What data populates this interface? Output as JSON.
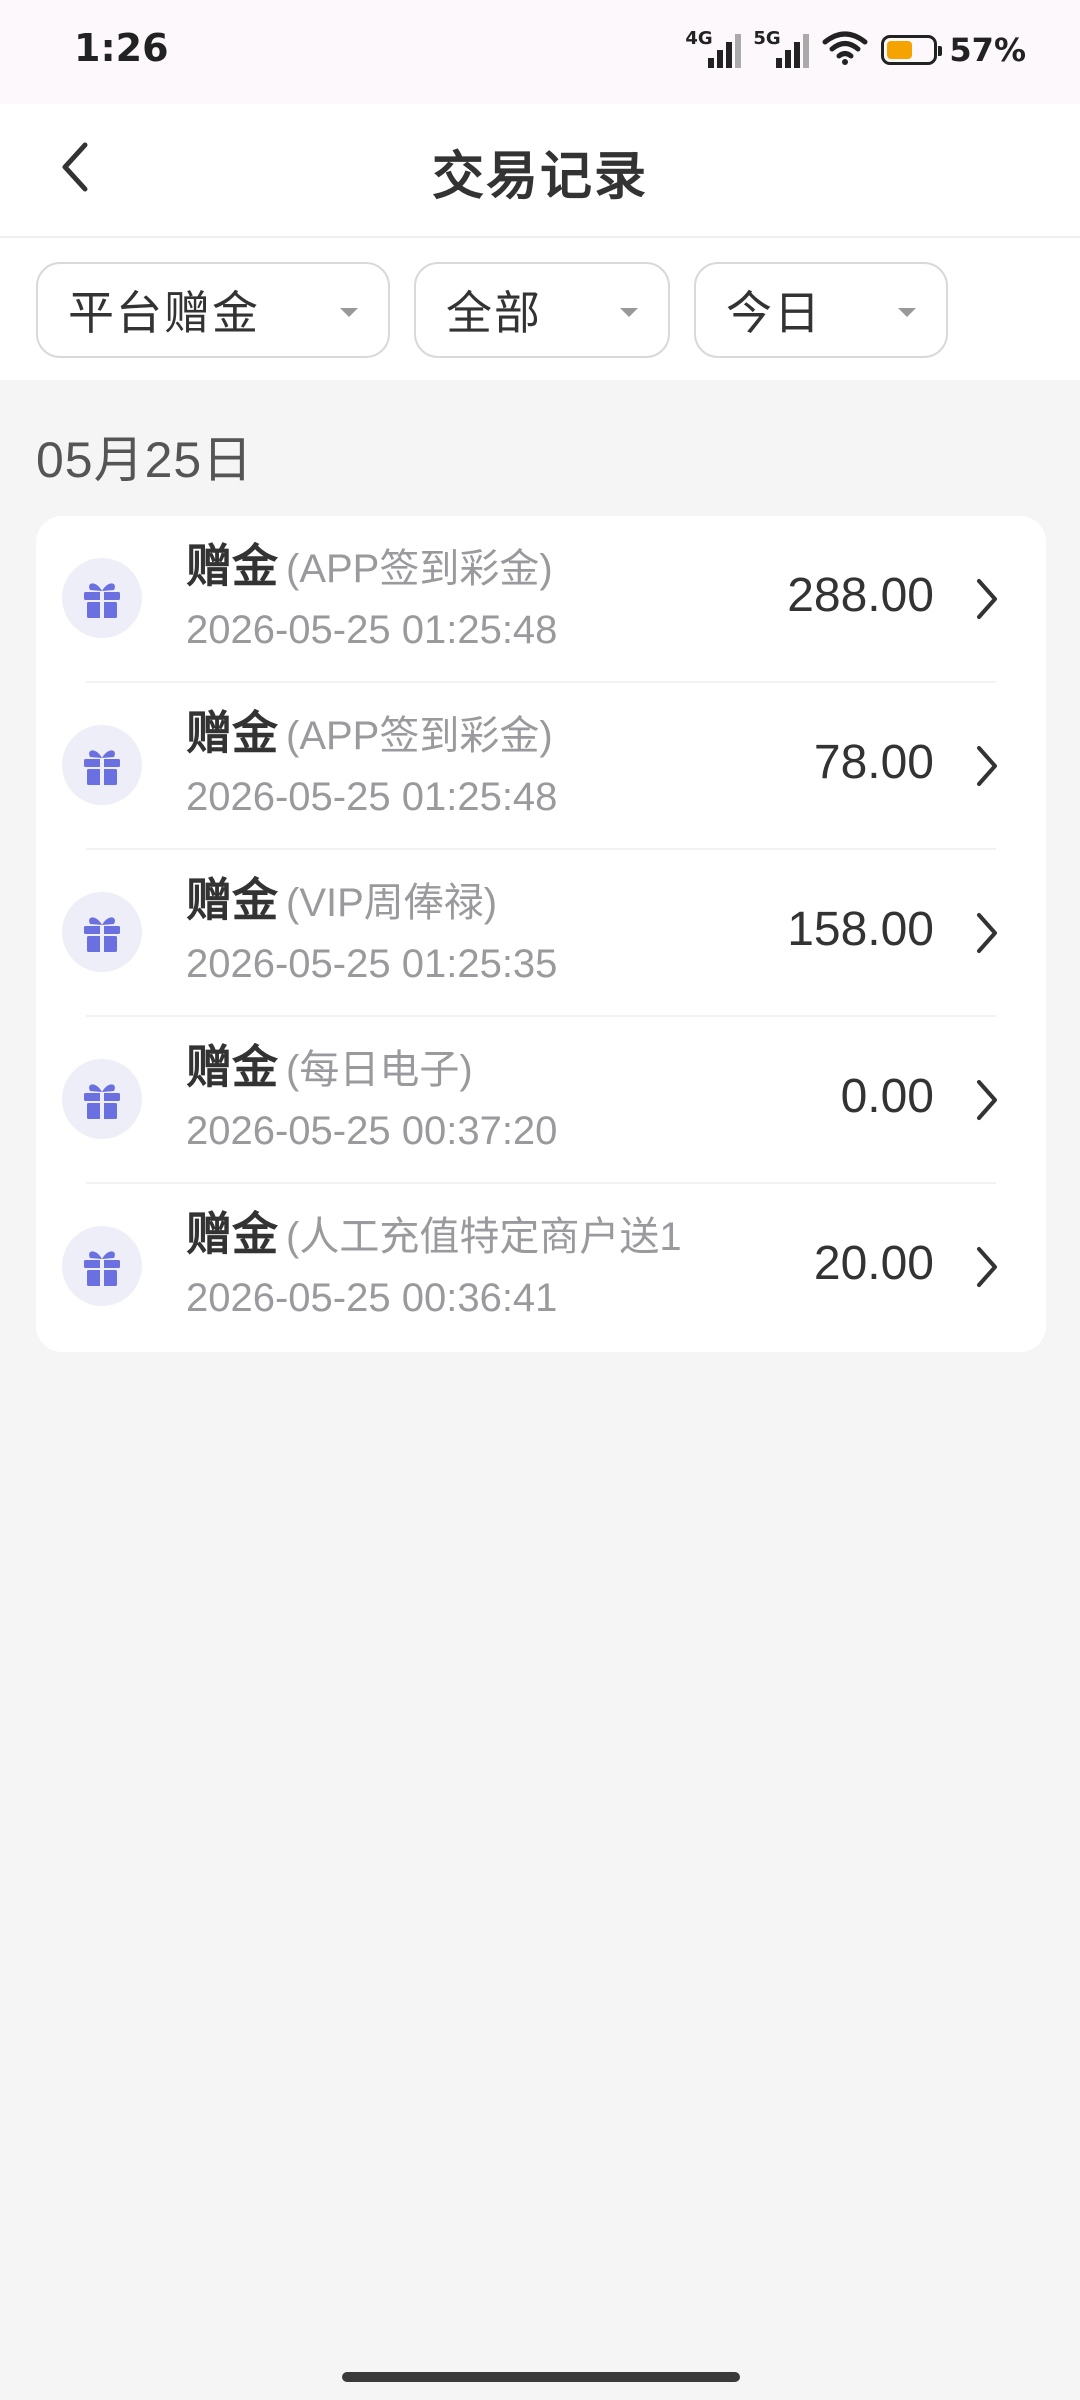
{
  "status_bar": {
    "time": "1:26",
    "network_1": "4G",
    "network_2": "5G",
    "battery_percent": "57%",
    "battery_level": 0.57
  },
  "header": {
    "title": "交易记录",
    "back_icon": "chevron-left-icon"
  },
  "filters": [
    {
      "label": "平台赠金",
      "icon": "caret-down-icon"
    },
    {
      "label": "全部",
      "icon": "caret-down-icon"
    },
    {
      "label": "今日",
      "icon": "caret-down-icon"
    }
  ],
  "date_group": "05月25日",
  "transactions": [
    {
      "type": "赠金",
      "reason": "(APP签到彩金)",
      "time": "2026-05-25 01:25:48",
      "amount": "288.00",
      "icon": "gift-icon"
    },
    {
      "type": "赠金",
      "reason": "(APP签到彩金)",
      "time": "2026-05-25 01:25:48",
      "amount": "78.00",
      "icon": "gift-icon"
    },
    {
      "type": "赠金",
      "reason": "(VIP周俸禄)",
      "time": "2026-05-25 01:25:35",
      "amount": "158.00",
      "icon": "gift-icon"
    },
    {
      "type": "赠金",
      "reason": "(每日电子)",
      "time": "2026-05-25 00:37:20",
      "amount": "0.00",
      "icon": "gift-icon"
    },
    {
      "type": "赠金",
      "reason": "(人工充值特定商户送1",
      "time": "2026-05-25 00:36:41",
      "amount": "20.00",
      "icon": "gift-icon"
    }
  ],
  "colors": {
    "accent_gift": "#6b70e0",
    "gift_badge_bg": "#eeeef8",
    "page_bg": "#f5f5f6"
  }
}
